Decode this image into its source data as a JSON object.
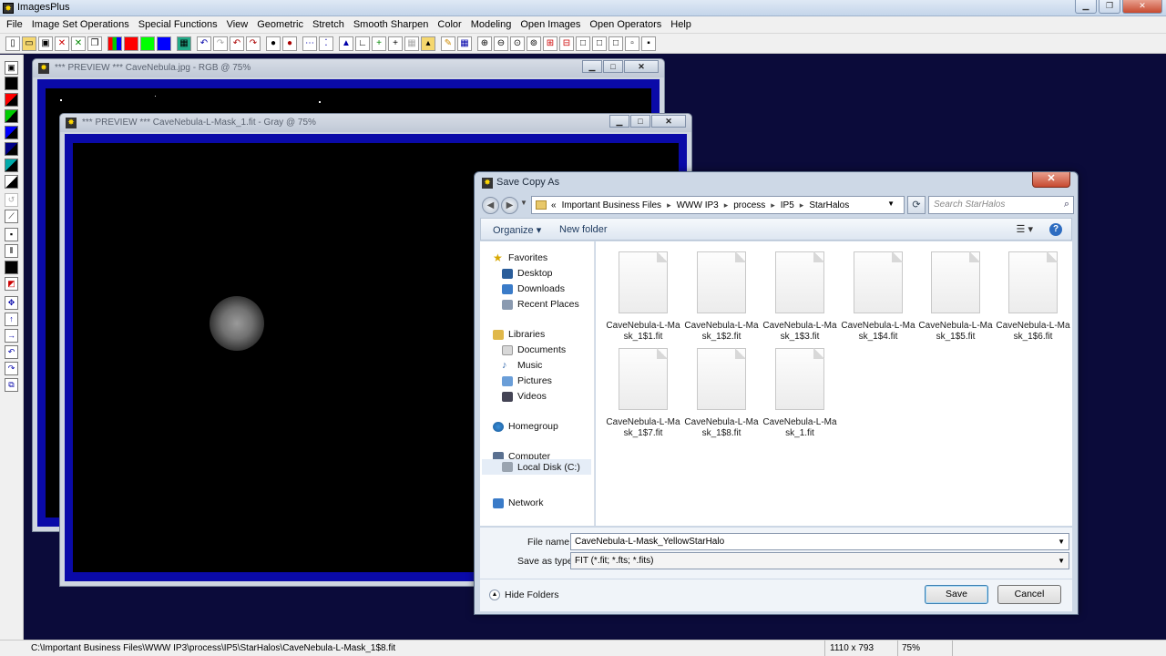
{
  "app": {
    "title": "ImagesPlus",
    "minimize": "▁",
    "restore": "❐",
    "close": "✕"
  },
  "menu": [
    "File",
    "Image Set Operations",
    "Special Functions",
    "View",
    "Geometric",
    "Stretch",
    "Smooth Sharpen",
    "Color",
    "Modeling",
    "Open Images",
    "Open Operators",
    "Help"
  ],
  "windows": {
    "rgb_preview": {
      "title": "*** PREVIEW *** CaveNebula.jpg - RGB @ 75%"
    },
    "mask_preview": {
      "title": "*** PREVIEW *** CaveNebula-L-Mask_1.fit - Gray @ 75%"
    }
  },
  "dialog": {
    "title": "Save Copy As",
    "close": "✕",
    "breadcrumb": [
      "«",
      "Important Business Files",
      "WWW IP3",
      "process",
      "IP5",
      "StarHalos"
    ],
    "search_placeholder": "Search StarHalos",
    "organize": "Organize ▾",
    "new_folder": "New folder",
    "nav": {
      "favorites": "Favorites",
      "desktop": "Desktop",
      "downloads": "Downloads",
      "recent": "Recent Places",
      "libraries": "Libraries",
      "documents": "Documents",
      "music": "Music",
      "pictures": "Pictures",
      "videos": "Videos",
      "homegroup": "Homegroup",
      "computer": "Computer",
      "localdisk": "Local Disk (C:)",
      "network": "Network"
    },
    "files": [
      "CaveNebula-L-Mask_1$1.fit",
      "CaveNebula-L-Mask_1$2.fit",
      "CaveNebula-L-Mask_1$3.fit",
      "CaveNebula-L-Mask_1$4.fit",
      "CaveNebula-L-Mask_1$5.fit",
      "CaveNebula-L-Mask_1$6.fit",
      "CaveNebula-L-Mask_1$7.fit",
      "CaveNebula-L-Mask_1$8.fit",
      "CaveNebula-L-Mask_1.fit"
    ],
    "file_name_label": "File name:",
    "file_name_value": "CaveNebula-L-Mask_YellowStarHalo",
    "save_type_label": "Save as type:",
    "save_type_value": "FIT (*.fit; *.fts; *.fits)",
    "hide_folders": "Hide Folders",
    "save": "Save",
    "cancel": "Cancel"
  },
  "status": {
    "path": "C:\\Important Business Files\\WWW IP3\\process\\IP5\\StarHalos\\CaveNebula-L-Mask_1$8.fit",
    "dimensions": "1110 x 793",
    "zoom": "75%"
  }
}
